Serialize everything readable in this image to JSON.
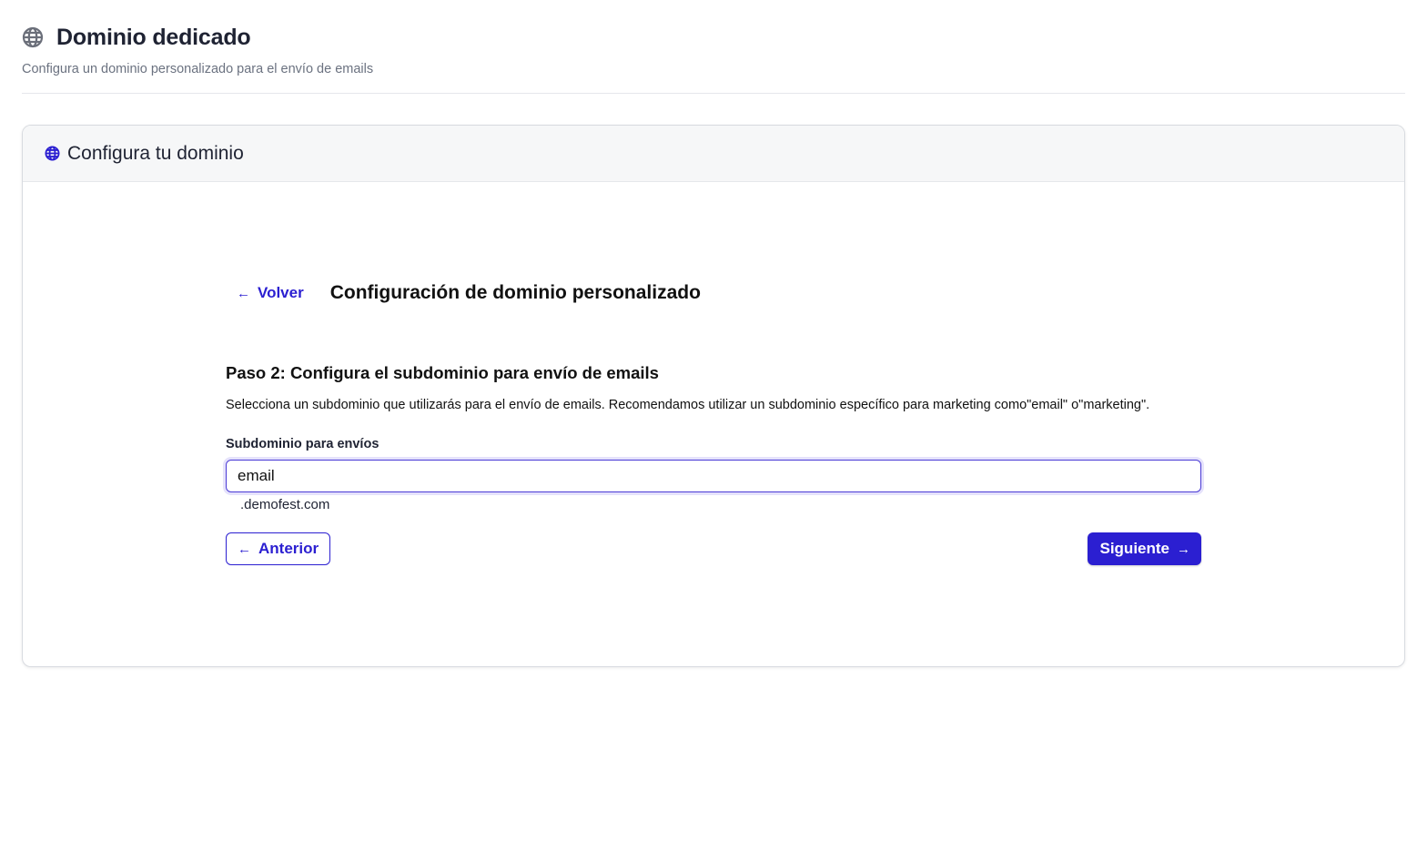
{
  "header": {
    "title": "Dominio dedicado",
    "subtitle": "Configura un dominio personalizado para el envío de emails",
    "icon": "globe-icon"
  },
  "card": {
    "title": "Configura tu dominio",
    "icon": "globe-icon"
  },
  "wizard": {
    "back_label": "Volver",
    "section_title": "Configuración de dominio personalizado",
    "step_title": "Paso 2: Configura el subdominio para envío de emails",
    "step_description": "Selecciona un subdominio que utilizarás para el envío de emails. Recomendamos utilizar un subdominio específico para marketing como\"email\" o\"marketing\".",
    "field_label": "Subdominio para envíos",
    "subdomain_value": "email",
    "domain_suffix": ".demofest.com",
    "prev_label": "Anterior",
    "next_label": "Siguiente"
  },
  "colors": {
    "accent": "#2b1fd1",
    "muted_text": "#6b7280",
    "card_header_bg": "#f6f7f8"
  }
}
